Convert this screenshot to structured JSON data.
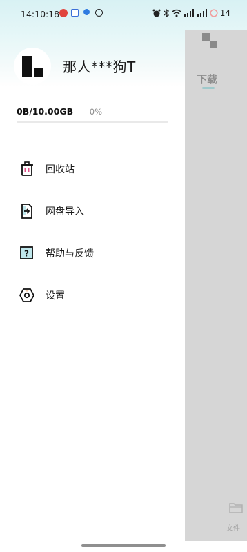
{
  "status_bar": {
    "time": "14:10:18",
    "battery": "14"
  },
  "background_app": {
    "tab_label": "下载",
    "bottom_nav_label": "文件"
  },
  "drawer": {
    "username": "那人***狗T",
    "storage": {
      "usage_text": "0B/10.00GB",
      "percent_text": "0%",
      "percent_value": 0
    },
    "menu": [
      {
        "label": "回收站",
        "icon": "trash-icon"
      },
      {
        "label": "网盘导入",
        "icon": "import-file-icon"
      },
      {
        "label": "帮助与反馈",
        "icon": "help-icon"
      },
      {
        "label": "设置",
        "icon": "settings-icon"
      }
    ]
  },
  "colors": {
    "accent": "#48b9c4",
    "header_tint": "#e3f6f7",
    "scrim": "#d6d6d6"
  }
}
